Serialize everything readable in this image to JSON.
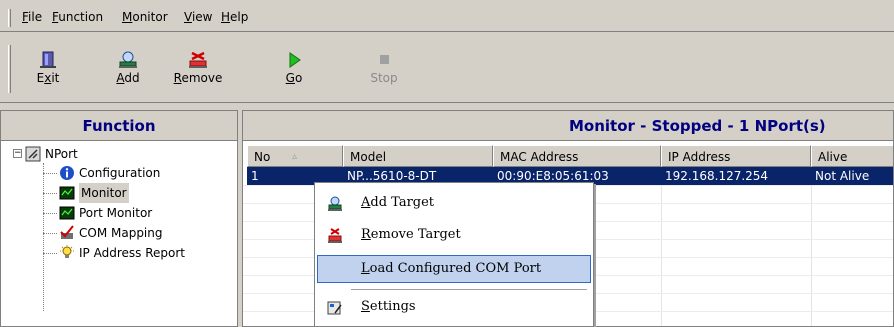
{
  "menubar": {
    "items": [
      {
        "pre": "",
        "u": "F",
        "post": "ile"
      },
      {
        "pre": "",
        "u": "F",
        "post": "unction"
      },
      {
        "pre": "",
        "u": "M",
        "post": "onitor"
      },
      {
        "pre": "",
        "u": "V",
        "post": "iew"
      },
      {
        "pre": "",
        "u": "H",
        "post": "elp"
      }
    ]
  },
  "toolbar": {
    "exit": {
      "pre": "E",
      "u": "x",
      "post": "it"
    },
    "add": {
      "pre": "",
      "u": "A",
      "post": "dd"
    },
    "remove": {
      "pre": "",
      "u": "R",
      "post": "emove"
    },
    "go": {
      "pre": "",
      "u": "G",
      "post": "o"
    },
    "stop": "Stop",
    "icons": [
      "exit-door-icon",
      "add-target-icon",
      "remove-target-icon",
      "go-arrow-icon",
      "stop-square-icon"
    ]
  },
  "left_panel": {
    "title": "Function",
    "tree": {
      "root": "NPort",
      "items": [
        {
          "label": "Configuration",
          "icon": "info-icon"
        },
        {
          "label": "Monitor",
          "icon": "monitor-icon"
        },
        {
          "label": "Port Monitor",
          "icon": "port-monitor-icon"
        },
        {
          "label": "COM Mapping",
          "icon": "com-mapping-icon"
        },
        {
          "label": "IP Address Report",
          "icon": "ip-report-bulb-icon"
        }
      ]
    }
  },
  "right_panel": {
    "title": "Monitor - Stopped - 1 NPort(s)",
    "columns": [
      "No",
      "Model",
      "MAC Address",
      "IP Address",
      "Alive"
    ],
    "rows": [
      {
        "no": "1",
        "model": "NP...5610-8-DT",
        "mac": "00:90:E8:05:61:03",
        "ip": "192.168.127.254",
        "alive": "Not Alive"
      }
    ]
  },
  "context_menu": {
    "items": [
      {
        "pre": "",
        "u": "A",
        "post": "dd Target",
        "icon": "add-target-icon"
      },
      {
        "pre": "",
        "u": "R",
        "post": "emove Target",
        "icon": "remove-target-icon"
      },
      {
        "pre": "",
        "u": "L",
        "post": "oad Configured COM Port",
        "icon": ""
      },
      {
        "pre": "",
        "u": "S",
        "post": "ettings",
        "icon": "settings-icon"
      }
    ],
    "highlighted_index": 2
  },
  "colors": {
    "header_text": "#000080",
    "selection": "#0a246a",
    "menu_highlight": "#c1d2ee"
  }
}
